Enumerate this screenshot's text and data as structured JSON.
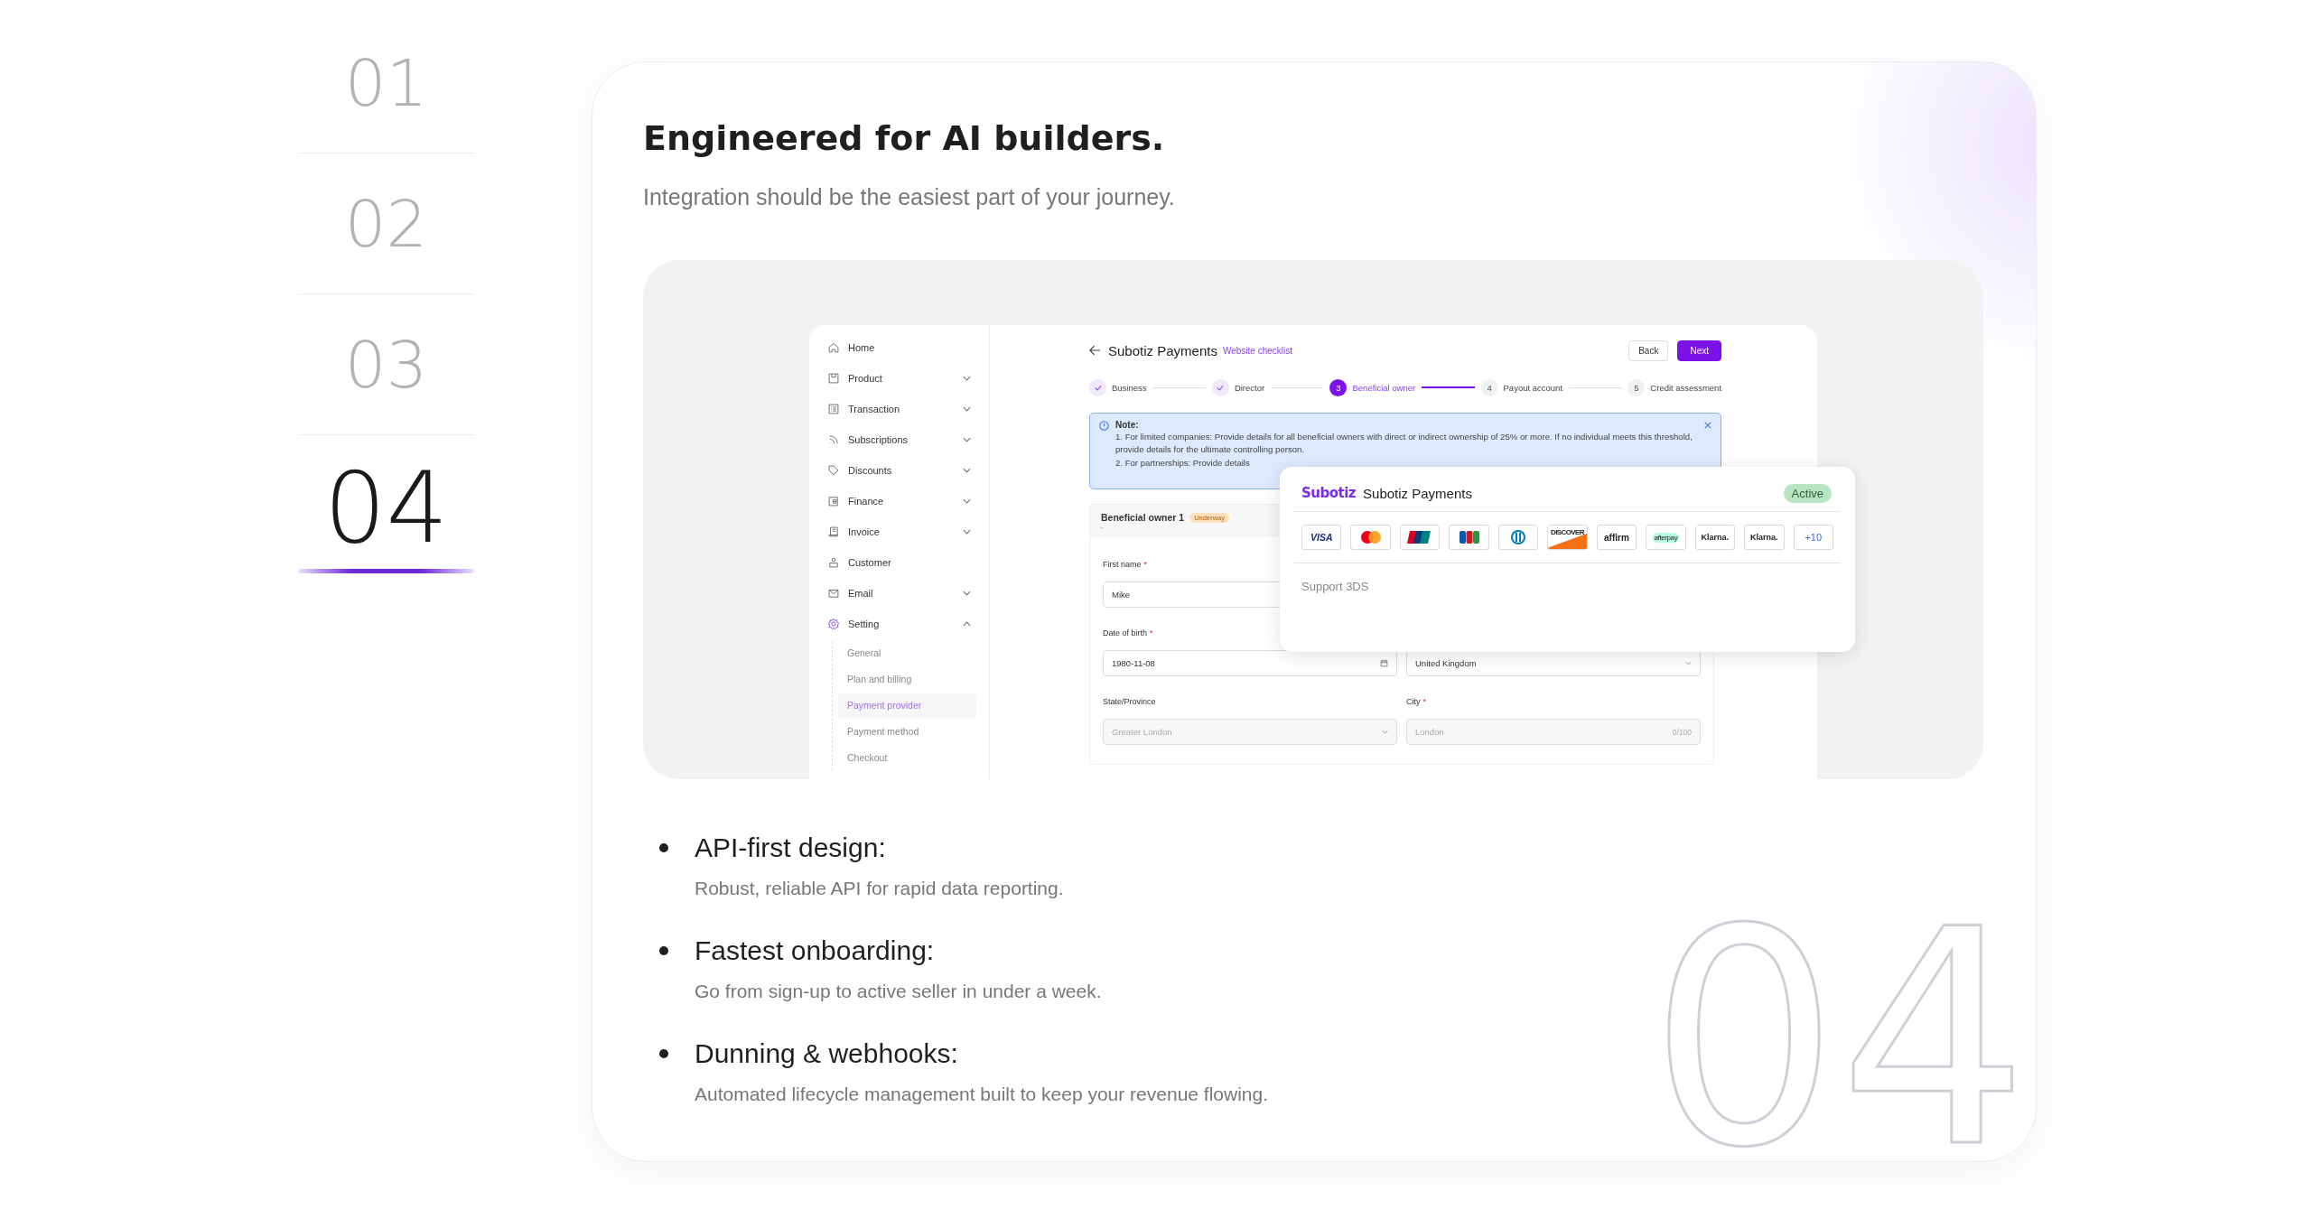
{
  "nav": [
    {
      "label": "01",
      "selected": false
    },
    {
      "label": "02",
      "selected": false
    },
    {
      "label": "03",
      "selected": false
    },
    {
      "label": "04",
      "selected": true
    }
  ],
  "card": {
    "title": "Engineered for AI builders.",
    "subtitle": "Integration should be the easiest part of your journey.",
    "backdrop_number": "04"
  },
  "app": {
    "sidebar": [
      {
        "label": "Home",
        "kind": "home",
        "active": false
      },
      {
        "label": "Product",
        "kind": "box",
        "expanded": false,
        "active": false
      },
      {
        "label": "Transaction",
        "kind": "list",
        "expanded": false,
        "active": false
      },
      {
        "label": "Subscriptions",
        "kind": "feed",
        "expanded": false,
        "active": false
      },
      {
        "label": "Discounts",
        "kind": "tag",
        "expanded": false,
        "active": false
      },
      {
        "label": "Finance",
        "kind": "wallet",
        "expanded": false,
        "active": false
      },
      {
        "label": "Invoice",
        "kind": "receipt",
        "expanded": false,
        "active": false
      },
      {
        "label": "Customer",
        "kind": "user",
        "active": false
      },
      {
        "label": "Email",
        "kind": "mail",
        "expanded": false,
        "active": false
      },
      {
        "label": "Setting",
        "kind": "gear",
        "expanded": true,
        "active": true,
        "children": [
          {
            "label": "General",
            "selected": false
          },
          {
            "label": "Plan and billing",
            "selected": false
          },
          {
            "label": "Payment provider",
            "selected": true
          },
          {
            "label": "Payment method",
            "selected": false
          },
          {
            "label": "Checkout",
            "selected": false
          }
        ]
      }
    ],
    "header": {
      "title": "Subotiz Payments",
      "link": "Website checklist",
      "buttons": [
        {
          "label": "Back",
          "kind": "secondary"
        },
        {
          "label": "Next",
          "kind": "primary"
        }
      ]
    },
    "steps": [
      {
        "label": "Business",
        "kind": "done"
      },
      {
        "label": "Director",
        "kind": "done"
      },
      {
        "label": "Beneficial owner",
        "number": "3",
        "kind": "current"
      },
      {
        "label": "Payout account",
        "number": "4",
        "kind": "pending"
      },
      {
        "label": "Credit assessment",
        "number": "5",
        "kind": "pending"
      }
    ],
    "note": {
      "title": "Note:",
      "lines": [
        "1. For limited companies: Provide details for all beneficial owners with direct or indirect ownership of 25% or more. If no individual meets this threshold, provide details for the ultimate controlling person.",
        "2. For partnerships: Provide details"
      ]
    },
    "form": {
      "title": "Beneficial owner 1",
      "badge": "Underway",
      "subtitle": "-",
      "required_mark": "*",
      "fields": [
        {
          "label": "First name",
          "required": true,
          "value": "Mike",
          "kind": "text",
          "disabled": false
        },
        {
          "label": "Date of birth",
          "required": true,
          "value": "1980-11-08",
          "kind": "date",
          "disabled": false
        },
        {
          "value": "United Kingdom",
          "kind": "select",
          "disabled": false
        },
        {
          "label": "State/Province",
          "required": false,
          "value": "Greater London",
          "kind": "select",
          "disabled": true
        },
        {
          "label": "City",
          "required": true,
          "value": "London",
          "counter": "0/100",
          "kind": "text",
          "disabled": true
        }
      ]
    },
    "popup": {
      "logo": "Subotiz",
      "title": "Subotiz Payments",
      "status": "Active",
      "methods": [
        {
          "kind": "visa",
          "text": "VISA"
        },
        {
          "kind": "mastercard"
        },
        {
          "kind": "unionpay"
        },
        {
          "kind": "jcb"
        },
        {
          "kind": "diners"
        },
        {
          "kind": "discover",
          "text": "DISCOVER"
        },
        {
          "kind": "affirm",
          "text": "affirm"
        },
        {
          "kind": "afterpay",
          "text": "afterpay"
        },
        {
          "kind": "klarna",
          "text": "Klarna."
        },
        {
          "kind": "klarna",
          "text": "Klarna."
        },
        {
          "kind": "more",
          "text": "+10"
        }
      ],
      "feature": "Support 3DS"
    }
  },
  "bullets": [
    {
      "heading": "API-first design:",
      "text": "Robust, reliable API for rapid data reporting."
    },
    {
      "heading": "Fastest onboarding:",
      "text": "Go from sign-up to active seller in under a week."
    },
    {
      "heading": "Dunning & webhooks:",
      "text": "Automated lifecycle management built to keep your revenue flowing."
    }
  ]
}
